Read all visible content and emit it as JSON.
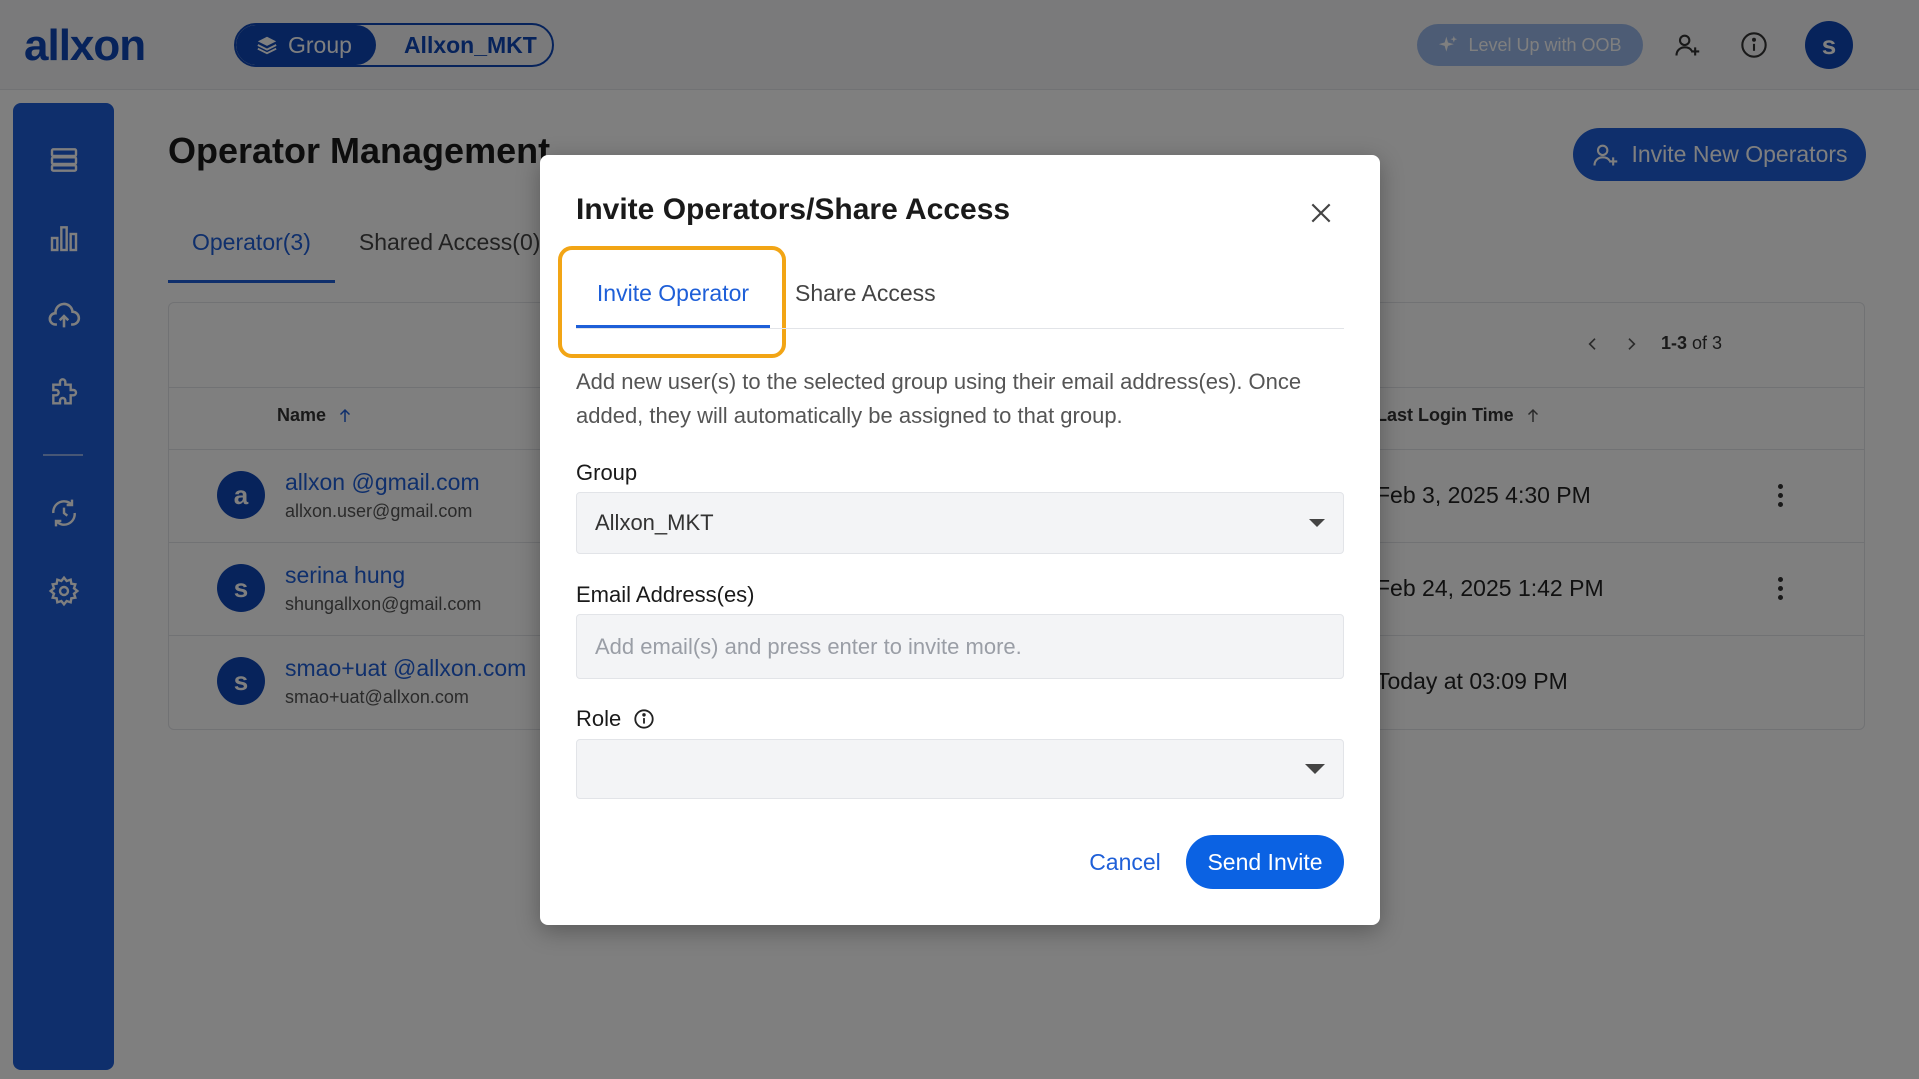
{
  "header": {
    "logo_text": "allxon",
    "group_label": "Group",
    "group_name": "Allxon_MKT",
    "levelup_label": "Level Up with OOB",
    "avatar_letter": "s"
  },
  "sidebar": {
    "icons": [
      "devices-icon",
      "chart-icon",
      "cloud-upload-icon",
      "plugin-icon",
      "ota-icon",
      "settings-icon"
    ]
  },
  "main": {
    "title": "Operator Management",
    "invite_button": "Invite New Operators",
    "tabs": [
      {
        "label": "Operator(3)"
      },
      {
        "label": "Shared Access(0)"
      }
    ],
    "pager": {
      "range": "1-3",
      "of": "of 3"
    },
    "columns": {
      "name": "Name",
      "last_login": "Last Login Time"
    },
    "rows": [
      {
        "avatar": "a",
        "name": "allxon @gmail.com",
        "email": "allxon.user@gmail.com",
        "last_login": "Feb 3, 2025 4:30 PM"
      },
      {
        "avatar": "s",
        "name": "serina hung",
        "email": "shungallxon@gmail.com",
        "last_login": "Feb 24, 2025 1:42 PM"
      },
      {
        "avatar": "s",
        "name": "smao+uat @allxon.com",
        "email": "smao+uat@allxon.com",
        "last_login": "Today at 03:09 PM"
      }
    ]
  },
  "modal": {
    "title": "Invite Operators/Share Access",
    "tabs": [
      {
        "label": "Invite Operator"
      },
      {
        "label": "Share Access"
      }
    ],
    "description": "Add new user(s) to the selected group using their email address(es). Once added, they will automatically be assigned to that group.",
    "group_label": "Group",
    "group_value": "Allxon_MKT",
    "email_label": "Email Address(es)",
    "email_placeholder": "Add email(s) and press enter to invite more.",
    "role_label": "Role",
    "role_value": "",
    "cancel_label": "Cancel",
    "send_label": "Send Invite"
  },
  "colors": {
    "primary": "#1e5fd8",
    "brand_dark": "#0f47b7",
    "highlight": "#f2a515"
  }
}
